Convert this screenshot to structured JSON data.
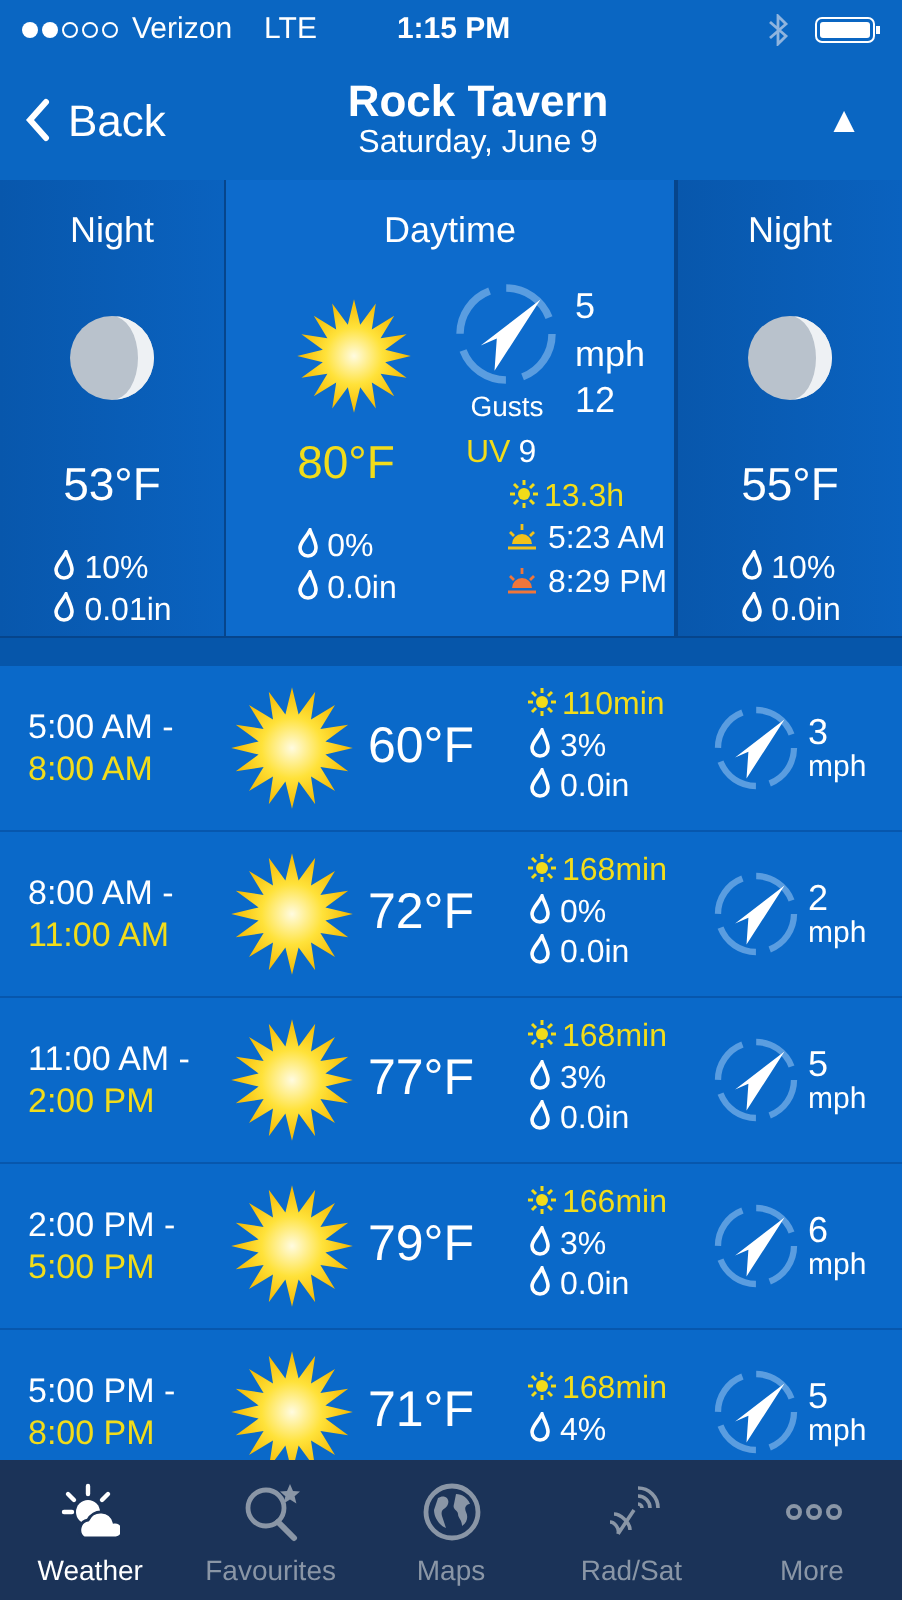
{
  "status_bar": {
    "carrier": "Verizon",
    "network": "LTE",
    "time": "1:15 PM"
  },
  "header": {
    "back": "Back",
    "title": "Rock Tavern",
    "subtitle": "Saturday, June 9",
    "action": "▲"
  },
  "periods": [
    {
      "kind": "night",
      "label": "Night",
      "temp": "53°F",
      "precip_chance": "10%",
      "precip_amount": "0.01in"
    },
    {
      "kind": "day",
      "label": "Daytime",
      "temp": "80°F",
      "precip_chance": "0%",
      "precip_amount": "0.0in",
      "wind_speed": "5",
      "wind_unit": "mph",
      "gusts_label": "Gusts",
      "gusts": "12",
      "uv_label": "UV",
      "uv": "9",
      "sunshine": "13.3h",
      "sunrise": "5:23 AM",
      "sunset": "8:29 PM"
    },
    {
      "kind": "night",
      "label": "Night",
      "temp": "55°F",
      "precip_chance": "10%",
      "precip_amount": "0.0in"
    }
  ],
  "hours": [
    {
      "start": "5:00 AM -",
      "end": "8:00 AM",
      "temp": "60°F",
      "sunshine": "110min",
      "precip_chance": "3%",
      "precip_amount": "0.0in",
      "wind_speed": "3",
      "wind_unit": "mph"
    },
    {
      "start": "8:00 AM -",
      "end": "11:00 AM",
      "temp": "72°F",
      "sunshine": "168min",
      "precip_chance": "0%",
      "precip_amount": "0.0in",
      "wind_speed": "2",
      "wind_unit": "mph"
    },
    {
      "start": "11:00 AM -",
      "end": "2:00 PM",
      "temp": "77°F",
      "sunshine": "168min",
      "precip_chance": "3%",
      "precip_amount": "0.0in",
      "wind_speed": "5",
      "wind_unit": "mph"
    },
    {
      "start": "2:00 PM -",
      "end": "5:00 PM",
      "temp": "79°F",
      "sunshine": "166min",
      "precip_chance": "3%",
      "precip_amount": "0.0in",
      "wind_speed": "6",
      "wind_unit": "mph"
    },
    {
      "start": "5:00 PM -",
      "end": "8:00 PM",
      "temp": "71°F",
      "sunshine": "168min",
      "precip_chance": "4%",
      "wind_speed": "5",
      "wind_unit": "mph"
    }
  ],
  "tabs": [
    {
      "label": "Weather",
      "selected": true
    },
    {
      "label": "Favourites",
      "selected": false
    },
    {
      "label": "Maps",
      "selected": false
    },
    {
      "label": "Rad/Sat",
      "selected": false
    },
    {
      "label": "More",
      "selected": false
    }
  ]
}
